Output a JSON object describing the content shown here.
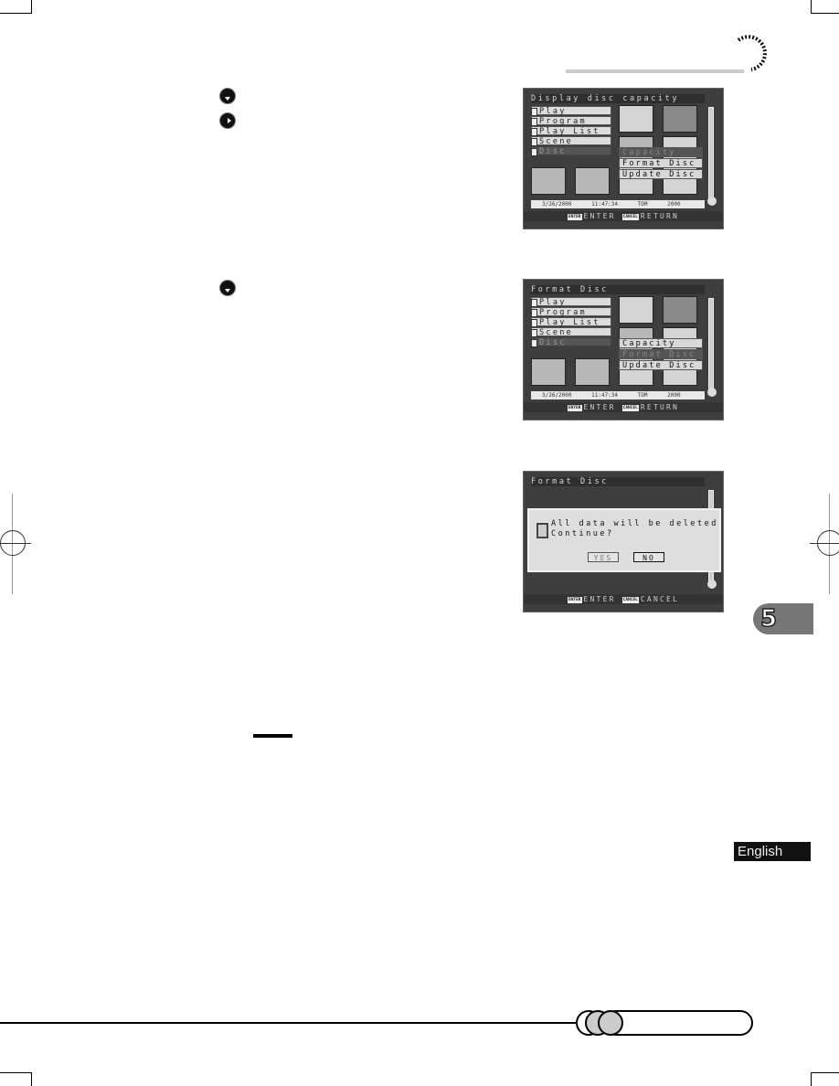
{
  "page": {
    "chapter_number": "5",
    "language_label": "English"
  },
  "steps": {
    "step_controls": [
      {
        "icon": "down-arrow-button-icon"
      },
      {
        "icon": "right-arrow-button-icon"
      },
      {
        "icon": "down-arrow-button-icon"
      }
    ]
  },
  "screens": [
    {
      "title": "Display disc capacity",
      "menu": [
        {
          "label": "Play",
          "state": "normal"
        },
        {
          "label": "Program",
          "state": "normal"
        },
        {
          "label": "Play List",
          "state": "normal"
        },
        {
          "label": "Scene",
          "state": "normal"
        },
        {
          "label": "Disc",
          "state": "selected"
        }
      ],
      "submenu": [
        {
          "label": "Capacity",
          "state": "highlighted"
        },
        {
          "label": "Format Disc",
          "state": "normal"
        },
        {
          "label": "Update Disc",
          "state": "normal"
        }
      ],
      "status": {
        "datetime": "3/26/2000 11:47:34",
        "count": "TOM 2000"
      },
      "footer": {
        "enter_key": "ENTER",
        "enter_label": "ENTER",
        "cancel_key": "CANCEL",
        "cancel_label": "RETURN"
      }
    },
    {
      "title": "Format Disc",
      "menu": [
        {
          "label": "Play",
          "state": "normal"
        },
        {
          "label": "Program",
          "state": "normal"
        },
        {
          "label": "Play List",
          "state": "normal"
        },
        {
          "label": "Scene",
          "state": "normal"
        },
        {
          "label": "Disc",
          "state": "selected"
        }
      ],
      "submenu": [
        {
          "label": "Capacity",
          "state": "normal"
        },
        {
          "label": "Format Disc",
          "state": "highlighted"
        },
        {
          "label": "Update Disc",
          "state": "normal"
        }
      ],
      "status": {
        "datetime": "3/26/2000 11:47:34",
        "count": "TOM 2000"
      },
      "footer": {
        "enter_key": "ENTER",
        "enter_label": "ENTER",
        "cancel_key": "CANCEL",
        "cancel_label": "RETURN"
      }
    },
    {
      "title": "Format Disc",
      "dialog": {
        "line1": "All data will be deleted",
        "line2": "Continue?",
        "yes_label": "YES",
        "no_label": "NO",
        "selected": "NO"
      },
      "footer": {
        "enter_key": "ENTER",
        "enter_label": "ENTER",
        "cancel_key": "CANCEL",
        "cancel_label": "CANCEL"
      }
    }
  ]
}
